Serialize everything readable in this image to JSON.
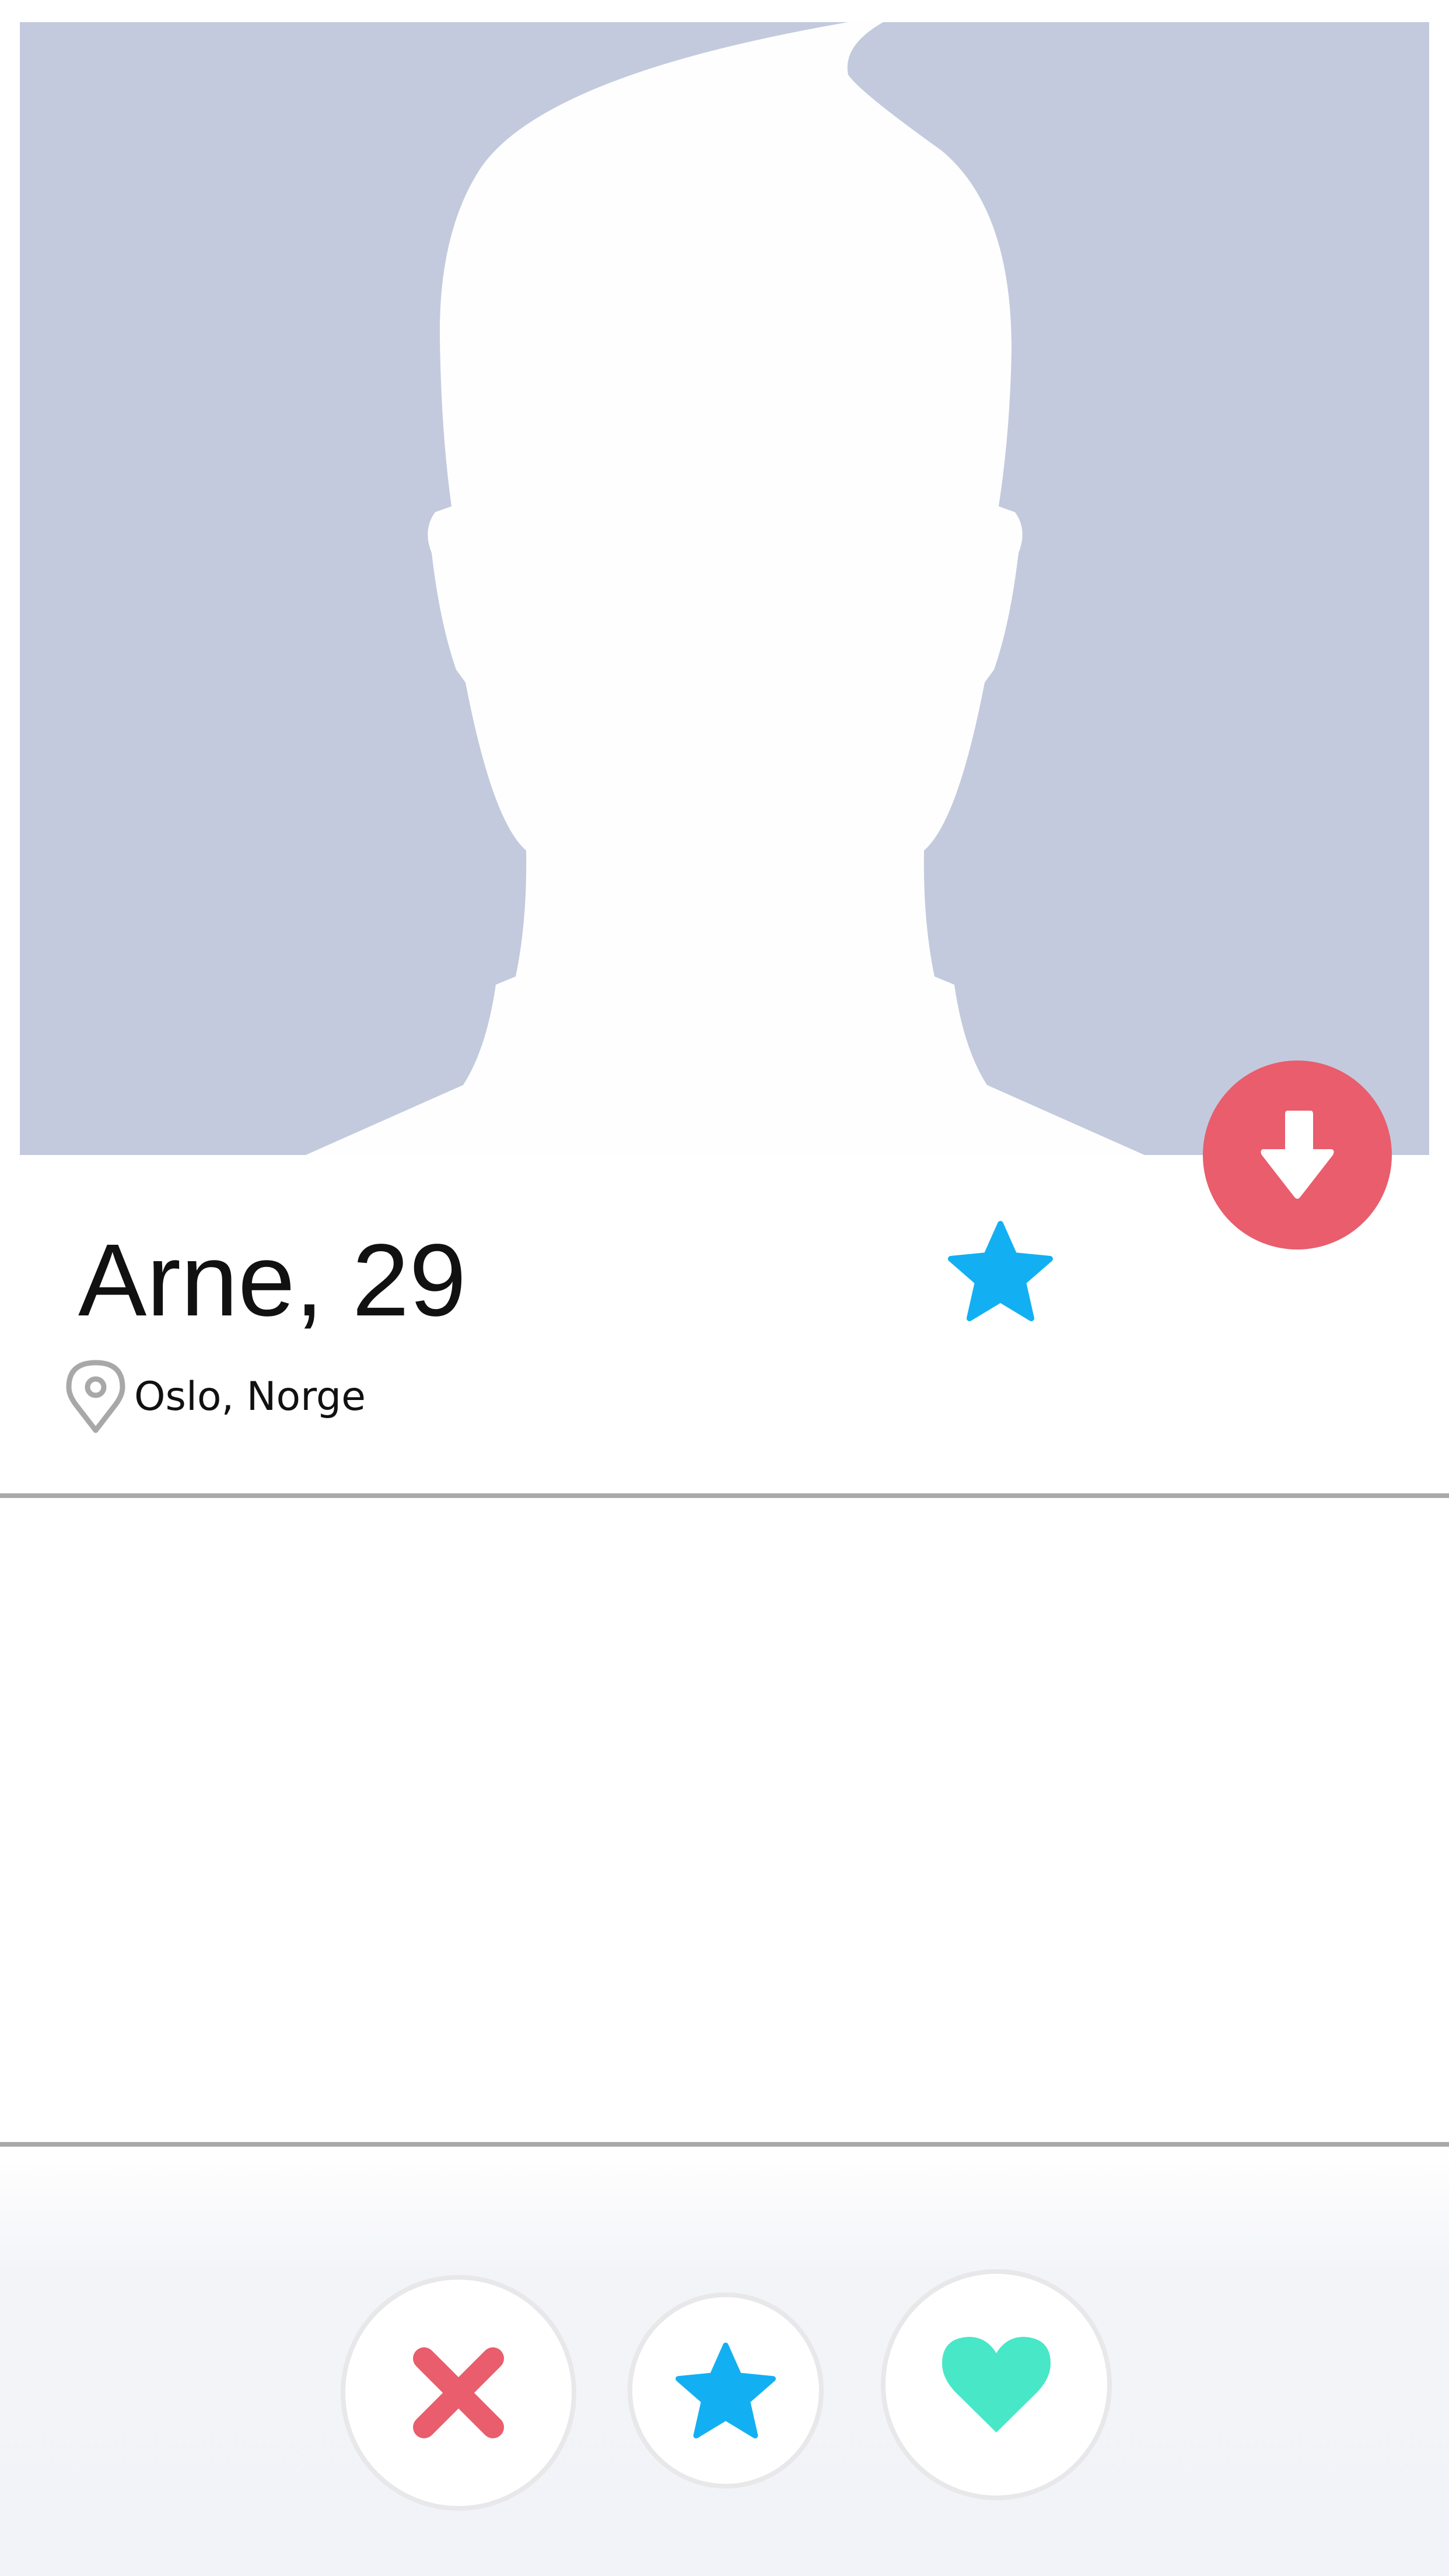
{
  "profile": {
    "name_age": "Arne, 29",
    "location": "Oslo, Norge"
  },
  "icons": {
    "expand": "arrow-down-icon",
    "profile_super_like": "star-icon",
    "location": "map-pin-icon",
    "dislike": "close-icon",
    "super_like": "star-icon",
    "like": "heart-icon"
  },
  "colors": {
    "photo_background": "#c3cadd",
    "silhouette": "#ffffff",
    "accent_red": "#e95d6c",
    "accent_blue": "#12b0f2",
    "accent_green": "#48e7c7",
    "divider": "#a9a9a9",
    "text": "#111111"
  }
}
